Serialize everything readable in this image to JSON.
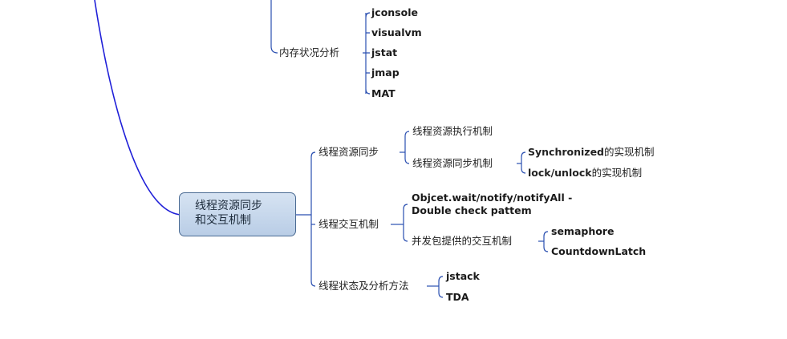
{
  "root": {
    "line1": "线程资源同步",
    "line2": "和交互机制"
  },
  "memory": {
    "label": "内存状况分析",
    "tools": [
      "jconsole",
      "visualvm",
      "jstat",
      "jmap",
      "MAT"
    ]
  },
  "sync": {
    "label": "线程资源同步",
    "children": {
      "exec": "线程资源执行机制",
      "sync_mech": "线程资源同步机制",
      "sync_leaves": [
        {
          "bold": "Synchronized",
          "rest": "的实现机制"
        },
        {
          "bold": "lock/unlock",
          "rest": "的实现机制"
        }
      ]
    }
  },
  "interact": {
    "label": "线程交互机制",
    "wait_line1": "Objcet.wait/notify/notifyAll -",
    "wait_line2": "Double check pattem",
    "concurrent": "并发包提供的交互机制",
    "concurrent_leaves": [
      "semaphore",
      "CountdownLatch"
    ]
  },
  "state": {
    "label": "线程状态及分析方法",
    "leaves": [
      "jstack",
      "TDA"
    ]
  },
  "colors": {
    "root_curve": "#1f1fd8",
    "lines": "#2a4fb0",
    "root_border": "#4b6b93"
  }
}
